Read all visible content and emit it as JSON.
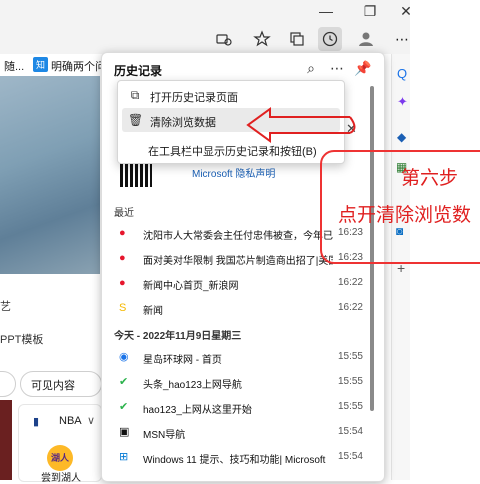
{
  "browser": {
    "fav_items": [
      "随...",
      "明确两个问"
    ],
    "fav_badge": "知"
  },
  "page": {
    "left_texts": [
      "艺",
      "PPT模板"
    ],
    "pill_text": "可见内容",
    "nba_label": "NBA",
    "nba_team_text": "湖人",
    "bottom_text": "尝到湖人"
  },
  "flyout": {
    "title": "历史记录",
    "menu": [
      {
        "label": "打开历史记录页面",
        "icon": "open-external-icon"
      },
      {
        "label": "清除浏览数据",
        "icon": "trash-icon"
      },
      {
        "label": "在工具栏中显示历史记录和按钮(B)",
        "icon": ""
      }
    ],
    "privacy_link": "Microsoft 隐私声明",
    "recent_heading": "最近",
    "today_heading": "今天 - 2022年11月9日星期三",
    "recent": [
      {
        "title": "沈阳市人大常委会主任付忠伟被查，今年已有",
        "time": "16:23",
        "icon": "weibo-icon"
      },
      {
        "title": "面对美对华限制 我国芯片制造商出招了|美国",
        "time": "16:23",
        "icon": "weibo-icon"
      },
      {
        "title": "新闻中心首页_新浪网",
        "time": "16:22",
        "icon": "weibo-icon"
      },
      {
        "title": "新闻",
        "time": "16:22",
        "icon": "s-icon"
      }
    ],
    "today": [
      {
        "title": "星岛环球网 - 首页",
        "time": "15:55",
        "icon": "globe-icon"
      },
      {
        "title": "头条_hao123上网导航",
        "time": "15:55",
        "icon": "hao123-icon"
      },
      {
        "title": "hao123_上网从这里开始",
        "time": "15:55",
        "icon": "hao123-icon"
      },
      {
        "title": "MSN导航",
        "time": "15:54",
        "icon": "msn-icon"
      },
      {
        "title": "Windows 11 提示、技巧和功能| Microsoft",
        "time": "15:54",
        "icon": "windows-icon"
      }
    ]
  },
  "annotation": {
    "step": "第六步",
    "instruction": "点开清除浏览数"
  },
  "colors": {
    "annotation": "#e02020",
    "link": "#1a5fb4"
  }
}
